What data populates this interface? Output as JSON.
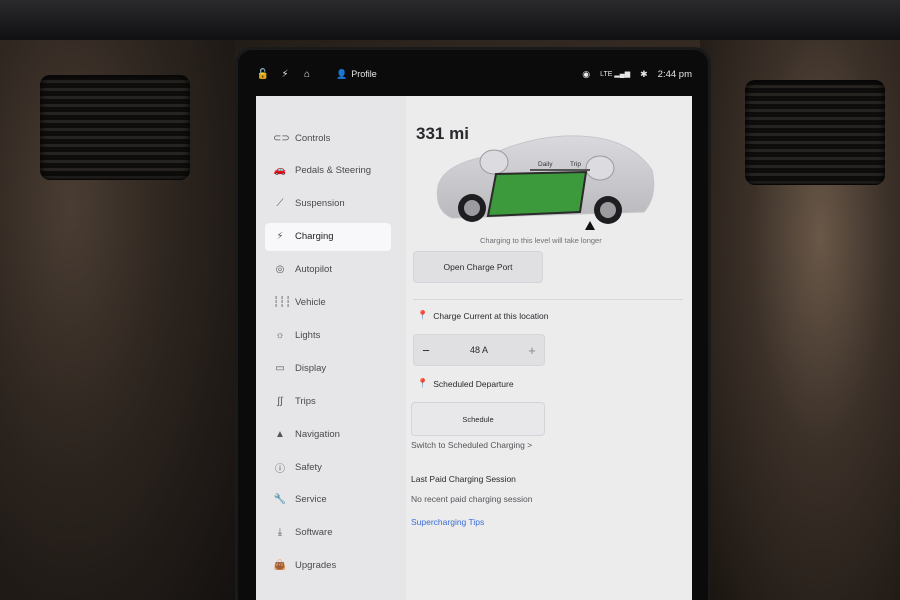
{
  "status_bar": {
    "icons": [
      "lock-icon",
      "bolt-icon",
      "garage-icon"
    ],
    "profile_label": "Profile",
    "lte_label": "LTE",
    "time": "2:44 pm"
  },
  "sidebar": {
    "items": [
      {
        "label": "Controls",
        "icon": "toggle-icon",
        "glyph": "⊂⊃"
      },
      {
        "label": "Pedals & Steering",
        "icon": "car-icon",
        "glyph": "🚗"
      },
      {
        "label": "Suspension",
        "icon": "wrench-icon",
        "glyph": "⟋"
      },
      {
        "label": "Charging",
        "icon": "bolt-icon",
        "glyph": "⚡",
        "active": true
      },
      {
        "label": "Autopilot",
        "icon": "steering-wheel-icon",
        "glyph": "◎"
      },
      {
        "label": "Vehicle",
        "icon": "sliders-icon",
        "glyph": "┆┆┆"
      },
      {
        "label": "Lights",
        "icon": "sun-icon",
        "glyph": "☼"
      },
      {
        "label": "Display",
        "icon": "display-icon",
        "glyph": "▭"
      },
      {
        "label": "Trips",
        "icon": "trips-icon",
        "glyph": "∫∫"
      },
      {
        "label": "Navigation",
        "icon": "navigation-arrow-icon",
        "glyph": "▲"
      },
      {
        "label": "Safety",
        "icon": "alert-circle-icon",
        "glyph": "ⓘ"
      },
      {
        "label": "Service",
        "icon": "service-wrench-icon",
        "glyph": "🔧"
      },
      {
        "label": "Software",
        "icon": "download-icon",
        "glyph": "⤓"
      },
      {
        "label": "Upgrades",
        "icon": "bag-icon",
        "glyph": "👜"
      }
    ]
  },
  "charging": {
    "range": "331 mi",
    "slider_labels": {
      "daily": "Daily",
      "trip": "Trip"
    },
    "charge_limit_fraction": 0.9,
    "hint": "Charging to this level will take longer",
    "open_port_label": "Open Charge Port",
    "current_label": "Charge Current at this location",
    "current_value": "48 A",
    "departure_label": "Scheduled Departure",
    "schedule_label": "Schedule",
    "switch_link": "Switch to Scheduled Charging >",
    "last_session_title": "Last Paid Charging Session",
    "last_session_value": "No recent paid charging session",
    "tips_link": "Supercharging Tips"
  },
  "colors": {
    "accent_link": "#3a6cd6",
    "battery_green": "#3c9a3c"
  }
}
